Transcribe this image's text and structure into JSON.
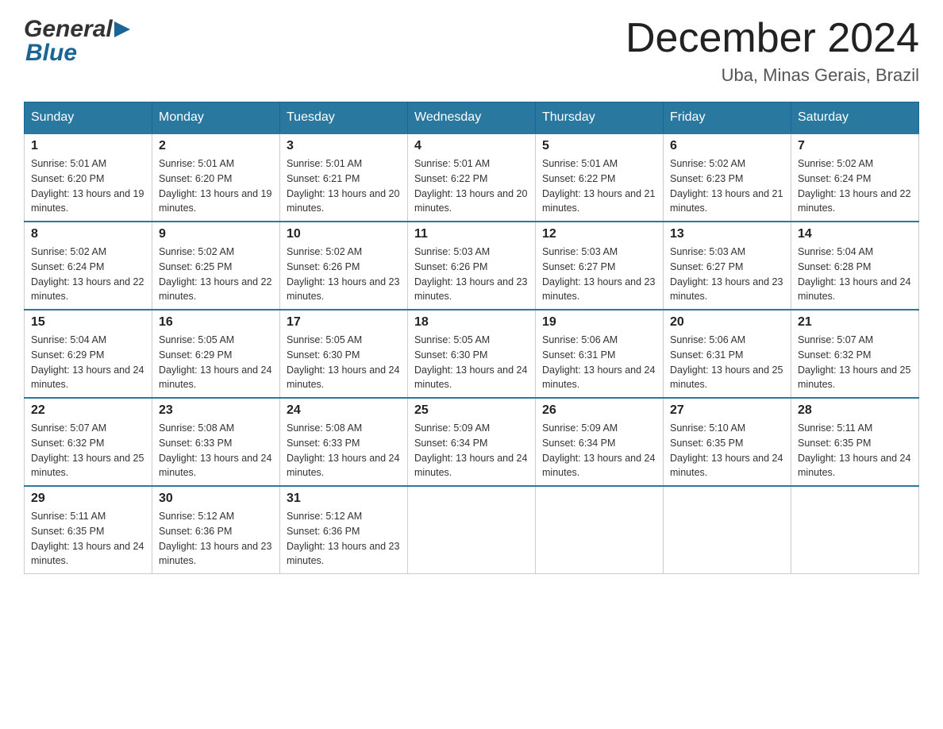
{
  "header": {
    "logo_general": "General",
    "logo_blue": "Blue",
    "month_title": "December 2024",
    "location": "Uba, Minas Gerais, Brazil"
  },
  "weekdays": [
    "Sunday",
    "Monday",
    "Tuesday",
    "Wednesday",
    "Thursday",
    "Friday",
    "Saturday"
  ],
  "weeks": [
    [
      {
        "day": "1",
        "sunrise": "5:01 AM",
        "sunset": "6:20 PM",
        "daylight": "13 hours and 19 minutes."
      },
      {
        "day": "2",
        "sunrise": "5:01 AM",
        "sunset": "6:20 PM",
        "daylight": "13 hours and 19 minutes."
      },
      {
        "day": "3",
        "sunrise": "5:01 AM",
        "sunset": "6:21 PM",
        "daylight": "13 hours and 20 minutes."
      },
      {
        "day": "4",
        "sunrise": "5:01 AM",
        "sunset": "6:22 PM",
        "daylight": "13 hours and 20 minutes."
      },
      {
        "day": "5",
        "sunrise": "5:01 AM",
        "sunset": "6:22 PM",
        "daylight": "13 hours and 21 minutes."
      },
      {
        "day": "6",
        "sunrise": "5:02 AM",
        "sunset": "6:23 PM",
        "daylight": "13 hours and 21 minutes."
      },
      {
        "day": "7",
        "sunrise": "5:02 AM",
        "sunset": "6:24 PM",
        "daylight": "13 hours and 22 minutes."
      }
    ],
    [
      {
        "day": "8",
        "sunrise": "5:02 AM",
        "sunset": "6:24 PM",
        "daylight": "13 hours and 22 minutes."
      },
      {
        "day": "9",
        "sunrise": "5:02 AM",
        "sunset": "6:25 PM",
        "daylight": "13 hours and 22 minutes."
      },
      {
        "day": "10",
        "sunrise": "5:02 AM",
        "sunset": "6:26 PM",
        "daylight": "13 hours and 23 minutes."
      },
      {
        "day": "11",
        "sunrise": "5:03 AM",
        "sunset": "6:26 PM",
        "daylight": "13 hours and 23 minutes."
      },
      {
        "day": "12",
        "sunrise": "5:03 AM",
        "sunset": "6:27 PM",
        "daylight": "13 hours and 23 minutes."
      },
      {
        "day": "13",
        "sunrise": "5:03 AM",
        "sunset": "6:27 PM",
        "daylight": "13 hours and 23 minutes."
      },
      {
        "day": "14",
        "sunrise": "5:04 AM",
        "sunset": "6:28 PM",
        "daylight": "13 hours and 24 minutes."
      }
    ],
    [
      {
        "day": "15",
        "sunrise": "5:04 AM",
        "sunset": "6:29 PM",
        "daylight": "13 hours and 24 minutes."
      },
      {
        "day": "16",
        "sunrise": "5:05 AM",
        "sunset": "6:29 PM",
        "daylight": "13 hours and 24 minutes."
      },
      {
        "day": "17",
        "sunrise": "5:05 AM",
        "sunset": "6:30 PM",
        "daylight": "13 hours and 24 minutes."
      },
      {
        "day": "18",
        "sunrise": "5:05 AM",
        "sunset": "6:30 PM",
        "daylight": "13 hours and 24 minutes."
      },
      {
        "day": "19",
        "sunrise": "5:06 AM",
        "sunset": "6:31 PM",
        "daylight": "13 hours and 24 minutes."
      },
      {
        "day": "20",
        "sunrise": "5:06 AM",
        "sunset": "6:31 PM",
        "daylight": "13 hours and 25 minutes."
      },
      {
        "day": "21",
        "sunrise": "5:07 AM",
        "sunset": "6:32 PM",
        "daylight": "13 hours and 25 minutes."
      }
    ],
    [
      {
        "day": "22",
        "sunrise": "5:07 AM",
        "sunset": "6:32 PM",
        "daylight": "13 hours and 25 minutes."
      },
      {
        "day": "23",
        "sunrise": "5:08 AM",
        "sunset": "6:33 PM",
        "daylight": "13 hours and 24 minutes."
      },
      {
        "day": "24",
        "sunrise": "5:08 AM",
        "sunset": "6:33 PM",
        "daylight": "13 hours and 24 minutes."
      },
      {
        "day": "25",
        "sunrise": "5:09 AM",
        "sunset": "6:34 PM",
        "daylight": "13 hours and 24 minutes."
      },
      {
        "day": "26",
        "sunrise": "5:09 AM",
        "sunset": "6:34 PM",
        "daylight": "13 hours and 24 minutes."
      },
      {
        "day": "27",
        "sunrise": "5:10 AM",
        "sunset": "6:35 PM",
        "daylight": "13 hours and 24 minutes."
      },
      {
        "day": "28",
        "sunrise": "5:11 AM",
        "sunset": "6:35 PM",
        "daylight": "13 hours and 24 minutes."
      }
    ],
    [
      {
        "day": "29",
        "sunrise": "5:11 AM",
        "sunset": "6:35 PM",
        "daylight": "13 hours and 24 minutes."
      },
      {
        "day": "30",
        "sunrise": "5:12 AM",
        "sunset": "6:36 PM",
        "daylight": "13 hours and 23 minutes."
      },
      {
        "day": "31",
        "sunrise": "5:12 AM",
        "sunset": "6:36 PM",
        "daylight": "13 hours and 23 minutes."
      },
      null,
      null,
      null,
      null
    ]
  ]
}
